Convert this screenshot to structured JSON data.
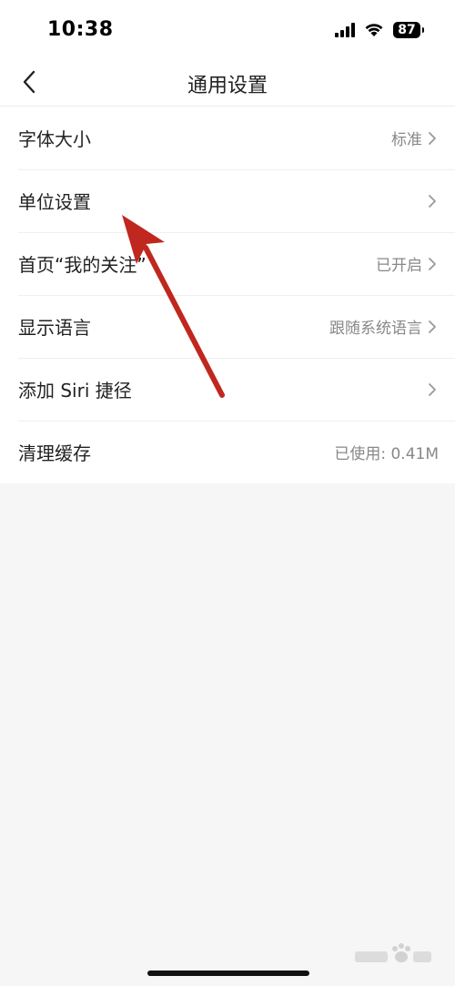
{
  "status_bar": {
    "time": "10:38",
    "battery": "87"
  },
  "nav": {
    "title": "通用设置"
  },
  "settings": [
    {
      "label": "字体大小",
      "value": "标准",
      "has_chevron": true
    },
    {
      "label": "单位设置",
      "value": "",
      "has_chevron": true
    },
    {
      "label": "首页“我的关注”",
      "value": "已开启",
      "has_chevron": true
    },
    {
      "label": "显示语言",
      "value": "跟随系统语言",
      "has_chevron": true
    },
    {
      "label": "添加 Siri 捷径",
      "value": "",
      "has_chevron": true
    },
    {
      "label": "清理缓存",
      "value": "已使用: 0.41M",
      "has_chevron": false
    }
  ],
  "icons": {
    "back": "chevron-left-icon",
    "row_chevron": "chevron-right-icon",
    "signal": "cellular-signal-icon",
    "wifi": "wifi-icon",
    "battery": "battery-icon",
    "annotation": "red-arrow-annotation",
    "watermark": "baidu-jingyan-watermark"
  },
  "colors": {
    "background": "#f6f6f6",
    "card": "#ffffff",
    "arrow": "#c0271e",
    "secondary_text": "#888888"
  }
}
